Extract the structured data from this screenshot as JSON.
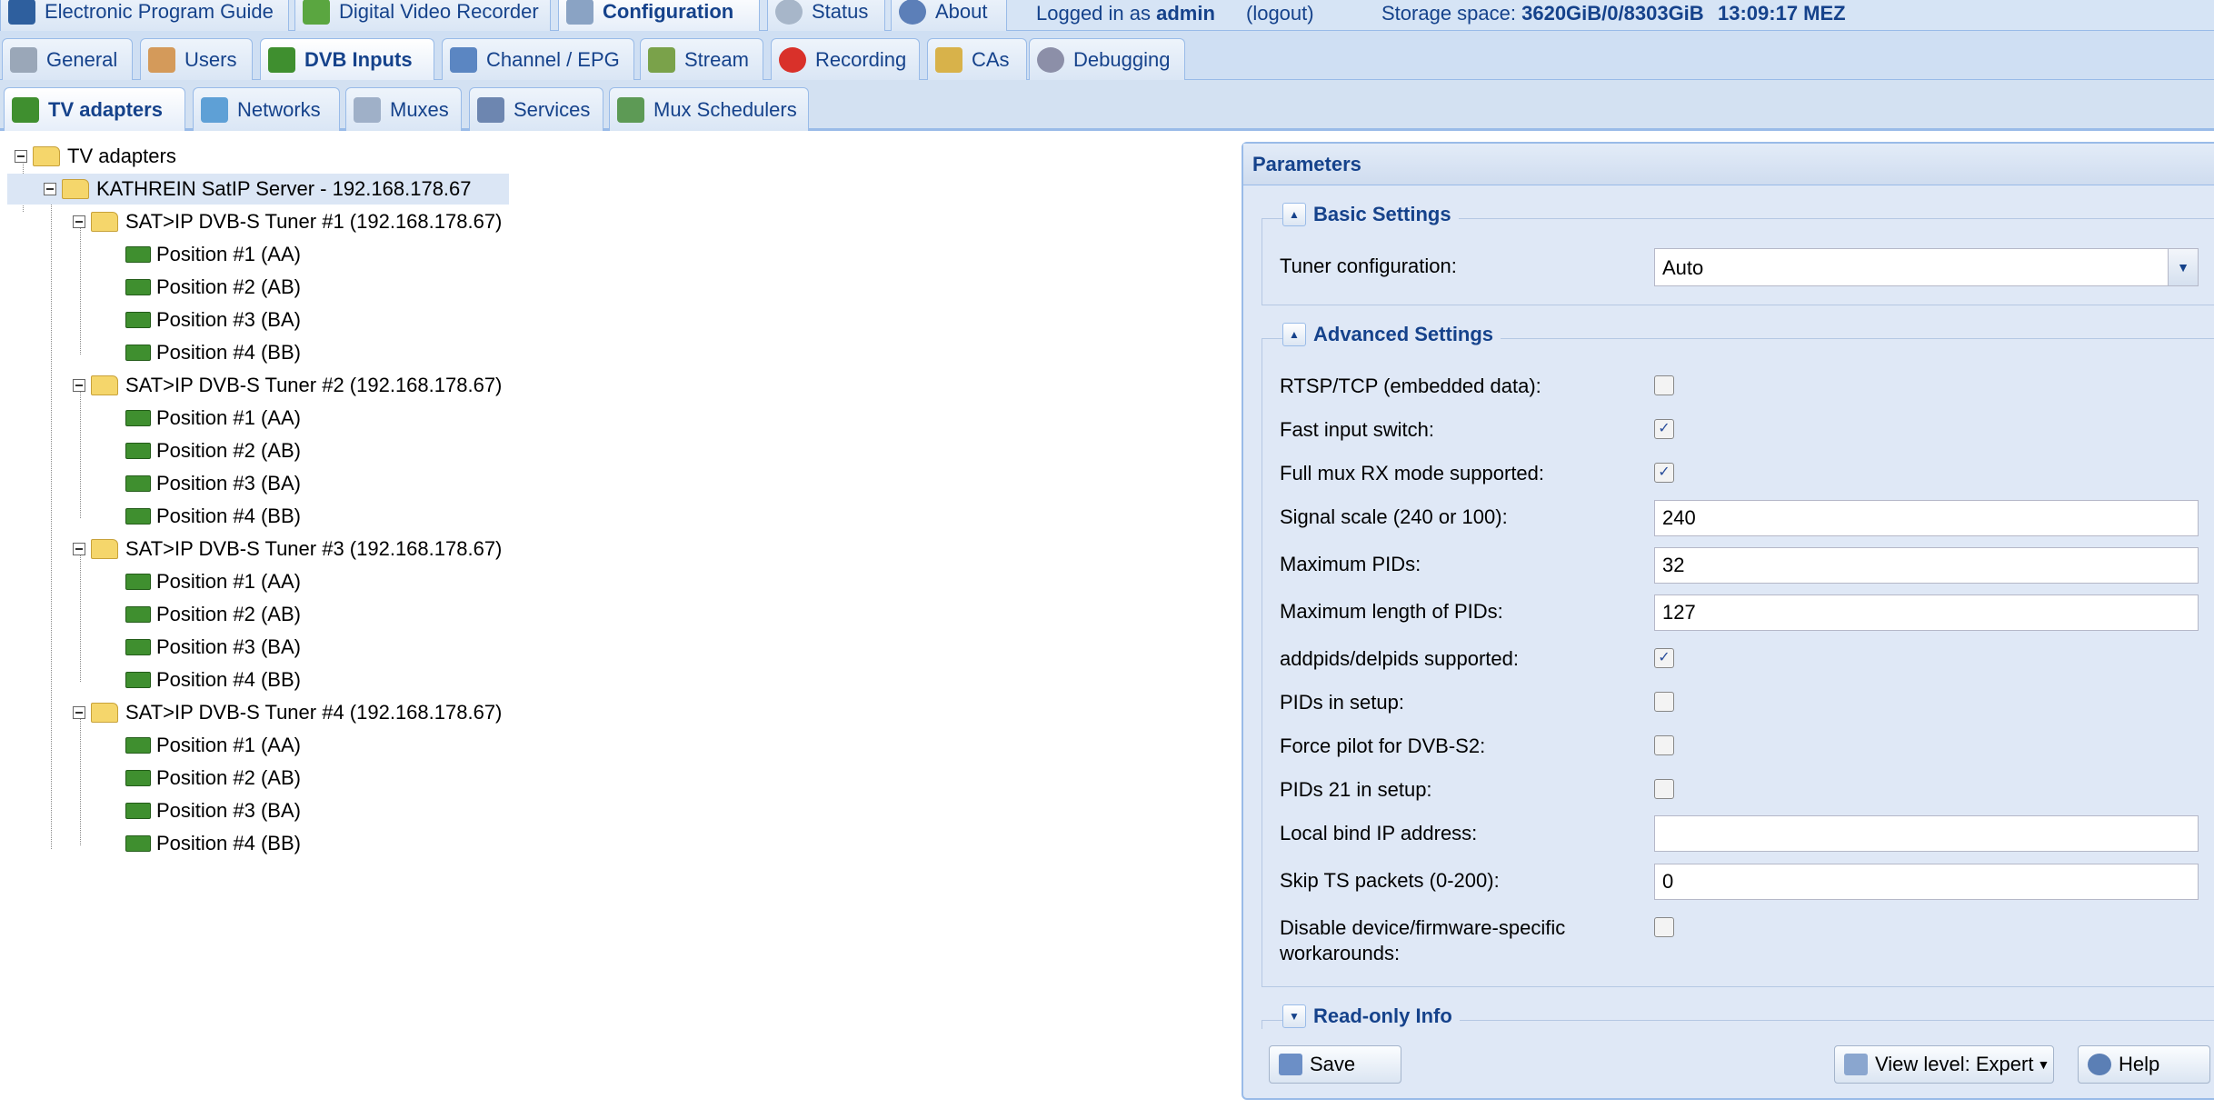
{
  "topbar": {
    "tabs": [
      {
        "label": "Electronic Program Guide",
        "icon": "epg-icon",
        "active": false
      },
      {
        "label": "Digital Video Recorder",
        "icon": "dvr-download-icon",
        "active": false
      },
      {
        "label": "Configuration",
        "icon": "wrench-icon",
        "active": true
      },
      {
        "label": "Status",
        "icon": "eye-icon",
        "active": false
      },
      {
        "label": "About",
        "icon": "info-icon",
        "active": false
      }
    ],
    "logged_in_prefix": "Logged in as",
    "username": "admin",
    "logout": "(logout)",
    "storage_label": "Storage space:",
    "storage_value": "3620GiB/0/8303GiB",
    "time": "13:09:17 MEZ"
  },
  "config_tabs": [
    {
      "label": "General",
      "icon": "tools-icon",
      "active": false
    },
    {
      "label": "Users",
      "icon": "users-icon",
      "active": false
    },
    {
      "label": "DVB Inputs",
      "icon": "tv-card-icon",
      "active": true
    },
    {
      "label": "Channel / EPG",
      "icon": "tv-icon",
      "active": false
    },
    {
      "label": "Stream",
      "icon": "stream-icon",
      "active": false
    },
    {
      "label": "Recording",
      "icon": "rec-icon",
      "active": false
    },
    {
      "label": "CAs",
      "icon": "key-icon",
      "active": false
    },
    {
      "label": "Debugging",
      "icon": "bug-icon",
      "active": false
    }
  ],
  "dvb_tabs": [
    {
      "label": "TV adapters",
      "icon": "tv-card-icon",
      "active": true
    },
    {
      "label": "Networks",
      "icon": "antenna-icon",
      "active": false
    },
    {
      "label": "Muxes",
      "icon": "mux-icon",
      "active": false
    },
    {
      "label": "Services",
      "icon": "services-icon",
      "active": false
    },
    {
      "label": "Mux Schedulers",
      "icon": "scheduler-icon",
      "active": false
    }
  ],
  "tree": {
    "root": "TV adapters",
    "server": "KATHREIN SatIP Server - 192.168.178.67",
    "tuners": [
      {
        "label": "SAT>IP DVB-S Tuner #1 (192.168.178.67)",
        "positions": [
          "Position #1 (AA)",
          "Position #2 (AB)",
          "Position #3 (BA)",
          "Position #4 (BB)"
        ]
      },
      {
        "label": "SAT>IP DVB-S Tuner #2 (192.168.178.67)",
        "positions": [
          "Position #1 (AA)",
          "Position #2 (AB)",
          "Position #3 (BA)",
          "Position #4 (BB)"
        ]
      },
      {
        "label": "SAT>IP DVB-S Tuner #3 (192.168.178.67)",
        "positions": [
          "Position #1 (AA)",
          "Position #2 (AB)",
          "Position #3 (BA)",
          "Position #4 (BB)"
        ]
      },
      {
        "label": "SAT>IP DVB-S Tuner #4 (192.168.178.67)",
        "positions": [
          "Position #1 (AA)",
          "Position #2 (AB)",
          "Position #3 (BA)",
          "Position #4 (BB)"
        ]
      }
    ]
  },
  "panel": {
    "title": "Parameters",
    "basic": {
      "title": "Basic Settings",
      "tuner_config_label": "Tuner configuration:",
      "tuner_config_value": "Auto"
    },
    "advanced": {
      "title": "Advanced Settings",
      "rtsp_label": "RTSP/TCP (embedded data):",
      "rtsp_checked": false,
      "fast_label": "Fast input switch:",
      "fast_checked": true,
      "fullmux_label": "Full mux RX mode supported:",
      "fullmux_checked": true,
      "signal_label": "Signal scale (240 or 100):",
      "signal_value": "240",
      "maxpids_label": "Maximum PIDs:",
      "maxpids_value": "32",
      "maxlen_label": "Maximum length of PIDs:",
      "maxlen_value": "127",
      "addpids_label": "addpids/delpids supported:",
      "addpids_checked": true,
      "pidsetup_label": "PIDs in setup:",
      "pidsetup_checked": false,
      "pilot_label": "Force pilot for DVB-S2:",
      "pilot_checked": false,
      "pids21_label": "PIDs 21 in setup:",
      "pids21_checked": false,
      "bindip_label": "Local bind IP address:",
      "bindip_value": "",
      "skipts_label": "Skip TS packets (0-200):",
      "skipts_value": "0",
      "disable_label_1": "Disable device/firmware-specific",
      "disable_label_2": "workarounds:",
      "disable_checked": false
    },
    "readonly_title": "Read-only Info",
    "save": "Save",
    "view_level": "View level: Expert",
    "help": "Help"
  },
  "colors": {
    "accent": "#15428b",
    "tab_border": "#99bbe8",
    "panel_bg": "#dfe8f6"
  }
}
